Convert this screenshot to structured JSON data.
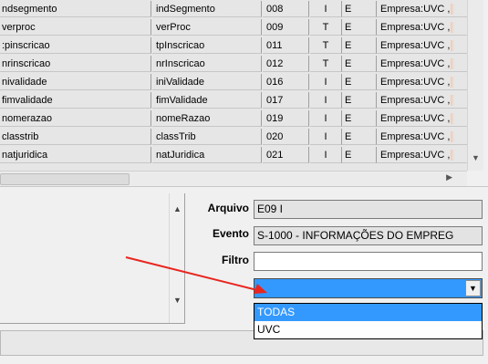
{
  "grid": {
    "rows": [
      {
        "c0": "ndsegmento",
        "c1": "indSegmento",
        "c2": "008",
        "c3": "I",
        "c4": "E",
        "c5": "Empresa:UVC ,"
      },
      {
        "c0": "verproc",
        "c1": "verProc",
        "c2": "009",
        "c3": "T",
        "c4": "E",
        "c5": "Empresa:UVC ,"
      },
      {
        "c0": ":pinscricao",
        "c1": "tpInscricao",
        "c2": "011",
        "c3": "T",
        "c4": "E",
        "c5": "Empresa:UVC ,"
      },
      {
        "c0": "nrinscricao",
        "c1": "nrInscricao",
        "c2": "012",
        "c3": "T",
        "c4": "E",
        "c5": "Empresa:UVC ,"
      },
      {
        "c0": "nivalidade",
        "c1": "iniValidade",
        "c2": "016",
        "c3": "I",
        "c4": "E",
        "c5": "Empresa:UVC ,"
      },
      {
        "c0": "fimvalidade",
        "c1": "fimValidade",
        "c2": "017",
        "c3": "I",
        "c4": "E",
        "c5": "Empresa:UVC ,"
      },
      {
        "c0": "nomerazao",
        "c1": "nomeRazao",
        "c2": "019",
        "c3": "I",
        "c4": "E",
        "c5": "Empresa:UVC ,"
      },
      {
        "c0": "classtrib",
        "c1": "classTrib",
        "c2": "020",
        "c3": "I",
        "c4": "E",
        "c5": "Empresa:UVC ,"
      },
      {
        "c0": "natjuridica",
        "c1": "natJuridica",
        "c2": "021",
        "c3": "I",
        "c4": "E",
        "c5": "Empresa:UVC ,"
      }
    ]
  },
  "form": {
    "arquivo_label": "Arquivo",
    "arquivo_value": "E09 I",
    "evento_label": "Evento",
    "evento_value": "S-1000 - INFORMAÇÕES DO EMPREG",
    "filtro_label": "Filtro",
    "filtro_value": "",
    "combo_value": "",
    "dropdown_options": [
      "TODAS",
      "UVC"
    ]
  },
  "icons": {
    "scroll_up": "▲",
    "scroll_down": "▼",
    "scroll_right": "▶",
    "combo_arrow": "▼"
  },
  "colors": {
    "selection": "#3399ff",
    "annotation_arrow": "#e8261f",
    "grid_bg": "#e6e6e6"
  }
}
